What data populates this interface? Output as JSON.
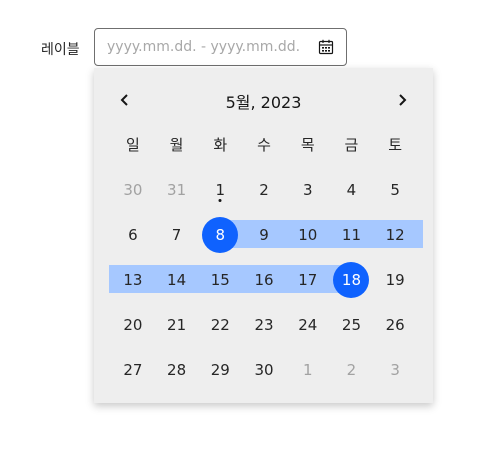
{
  "field": {
    "label": "레이블",
    "placeholder": "yyyy.mm.dd. - yyyy.mm.dd.",
    "value": ""
  },
  "calendar": {
    "month_title": "5월, 2023",
    "weekdays": [
      "일",
      "월",
      "화",
      "수",
      "목",
      "금",
      "토"
    ],
    "weeks": [
      [
        {
          "d": "30",
          "out": true
        },
        {
          "d": "31",
          "out": true
        },
        {
          "d": "1",
          "today": true
        },
        {
          "d": "2"
        },
        {
          "d": "3"
        },
        {
          "d": "4"
        },
        {
          "d": "5"
        }
      ],
      [
        {
          "d": "6"
        },
        {
          "d": "7"
        },
        {
          "d": "8",
          "start": true
        },
        {
          "d": "9",
          "inrange": true
        },
        {
          "d": "10",
          "inrange": true
        },
        {
          "d": "11",
          "inrange": true
        },
        {
          "d": "12",
          "inrange": true
        }
      ],
      [
        {
          "d": "13",
          "inrange": true
        },
        {
          "d": "14",
          "inrange": true
        },
        {
          "d": "15",
          "inrange": true
        },
        {
          "d": "16",
          "inrange": true
        },
        {
          "d": "17",
          "inrange": true
        },
        {
          "d": "18",
          "end": true
        },
        {
          "d": "19"
        }
      ],
      [
        {
          "d": "20"
        },
        {
          "d": "21"
        },
        {
          "d": "22"
        },
        {
          "d": "23"
        },
        {
          "d": "24"
        },
        {
          "d": "25"
        },
        {
          "d": "26"
        }
      ],
      [
        {
          "d": "27"
        },
        {
          "d": "28"
        },
        {
          "d": "29"
        },
        {
          "d": "30"
        },
        {
          "d": "1",
          "out": true
        },
        {
          "d": "2",
          "out": true
        },
        {
          "d": "3",
          "out": true
        }
      ]
    ]
  },
  "colors": {
    "accent": "#0f62fe",
    "range": "#a6c8ff",
    "popover_bg": "#eeeeee"
  }
}
